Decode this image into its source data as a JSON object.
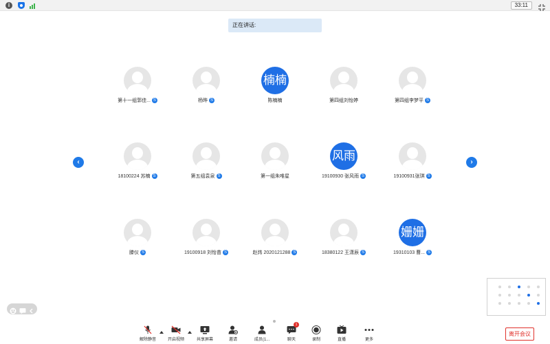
{
  "topbar": {
    "timer": "33:11",
    "icons": [
      "info-icon",
      "shield-icon",
      "signal-icon",
      "exit-fullscreen-icon"
    ]
  },
  "speaking": {
    "label": "正在讲话:"
  },
  "navigation": {
    "prev": "‹",
    "next": "›"
  },
  "participants": [
    {
      "name": "第十一组郭佳...",
      "avatar": "",
      "mic": true
    },
    {
      "name": "杨晔",
      "avatar": "",
      "mic": true
    },
    {
      "name": "陈楠楠",
      "avatar": "楠楠",
      "mic": false
    },
    {
      "name": "第四组刘怡婷",
      "avatar": "",
      "mic": false
    },
    {
      "name": "第四组李梦平",
      "avatar": "",
      "mic": true
    },
    {
      "name": "18100224 苏楠",
      "avatar": "",
      "mic": true
    },
    {
      "name": "第五组袁泉",
      "avatar": "",
      "mic": true
    },
    {
      "name": "第一组朱唯星",
      "avatar": "",
      "mic": false
    },
    {
      "name": "19100930 张风雨",
      "avatar": "风雨",
      "mic": true
    },
    {
      "name": "19100931张琪",
      "avatar": "",
      "mic": true
    },
    {
      "name": "滕仪",
      "avatar": "",
      "mic": true
    },
    {
      "name": "19100918 刘怡苗",
      "avatar": "",
      "mic": true
    },
    {
      "name": "赵炜 2020121288",
      "avatar": "",
      "mic": true
    },
    {
      "name": "18380122 王潇辰",
      "avatar": "",
      "mic": true
    },
    {
      "name": "19310103 曹...",
      "avatar": "姗姗",
      "mic": true
    }
  ],
  "mic_badge": "S",
  "toolbar": {
    "unmute": "解除静音",
    "start_video": "开启视频",
    "share_screen": "共享屏幕",
    "invite": "邀请",
    "members": "成员(1...",
    "chat": "聊天",
    "chat_badge": "1",
    "record": "录制",
    "live": "直播",
    "more": "更多"
  },
  "leave_button": "离开会议",
  "colors": {
    "accent": "#1f7ae8",
    "danger": "#e0302a",
    "speaking_bg": "#dbe9f7"
  }
}
